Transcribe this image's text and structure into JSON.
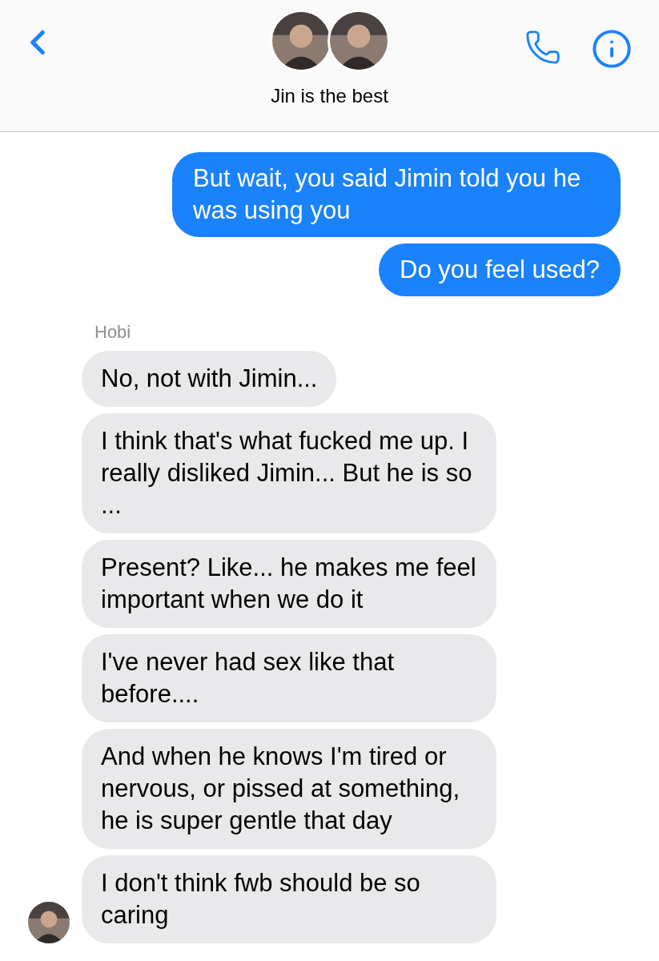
{
  "header": {
    "title": "Jin is the best"
  },
  "messages": [
    {
      "kind": "sent",
      "text": "But wait, you said Jimin told you he was using you"
    },
    {
      "kind": "sent",
      "text": "Do you feel used?"
    },
    {
      "kind": "sender_name",
      "text": "Hobi"
    },
    {
      "kind": "received",
      "text": "No, not with Jimin..."
    },
    {
      "kind": "received",
      "text": "I think that's what fucked me up. I really disliked Jimin... But he is so ..."
    },
    {
      "kind": "received",
      "text": "Present? Like... he makes me feel important when we do it"
    },
    {
      "kind": "received",
      "text": "I've never had sex like that before...."
    },
    {
      "kind": "received",
      "text": "And when he knows I'm tired or nervous, or pissed at something, he is super gentle that day"
    },
    {
      "kind": "received",
      "text": "I don't think fwb should be so caring",
      "avatar": true
    }
  ]
}
